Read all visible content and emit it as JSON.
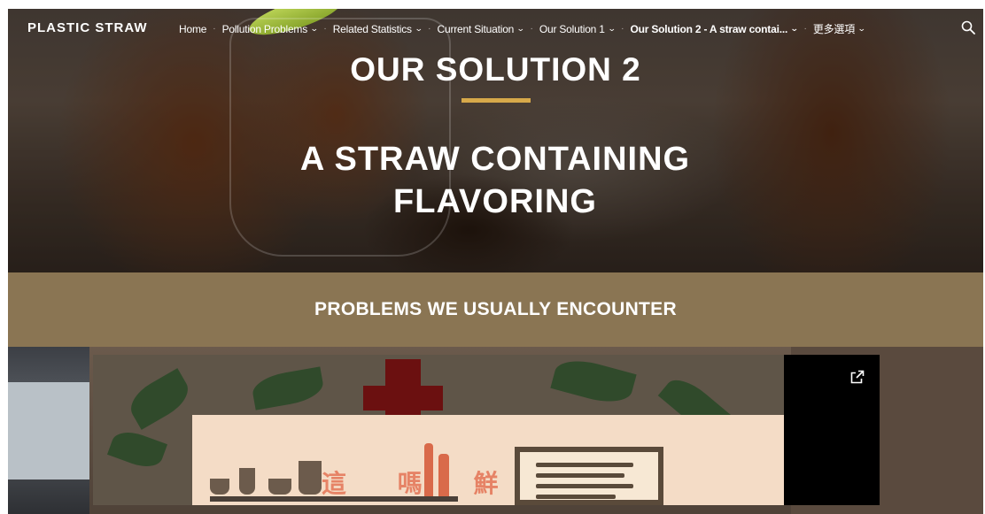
{
  "brand": "PLASTIC STRAW",
  "nav": {
    "items": [
      {
        "label": "Home",
        "dropdown": false,
        "active": false
      },
      {
        "label": "Pollution Problems",
        "dropdown": true,
        "active": false
      },
      {
        "label": "Related Statistics",
        "dropdown": true,
        "active": false
      },
      {
        "label": "Current Situation",
        "dropdown": true,
        "active": false
      },
      {
        "label": "Our Solution 1",
        "dropdown": true,
        "active": false
      },
      {
        "label": "Our Solution 2 - A straw contai...",
        "dropdown": true,
        "active": true
      },
      {
        "label": "更多選項",
        "dropdown": true,
        "active": false
      }
    ],
    "search_icon": "search-icon"
  },
  "hero": {
    "title": "OUR SOLUTION 2",
    "subtitle_line1": "A STRAW CONTAINING",
    "subtitle_line2": "FLAVORING",
    "accent_color": "#d7a94a"
  },
  "band": {
    "heading": "PROBLEMS WE USUALLY ENCOUNTER",
    "color": "#8a7553"
  },
  "embed": {
    "open_icon": "open-in-new-icon",
    "image_text": "這 嗎 鮮 耶"
  }
}
